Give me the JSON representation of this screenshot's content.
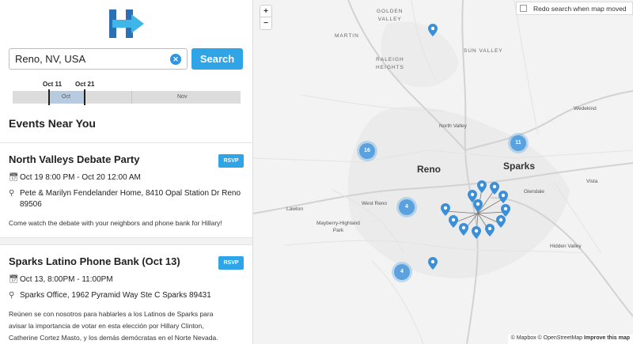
{
  "search": {
    "value": "Reno, NV, USA",
    "button_label": "Search"
  },
  "timeline": {
    "start_label": "Oct 11",
    "end_label": "Oct 21",
    "months": [
      "Oct",
      "Nov"
    ]
  },
  "events_heading": "Events Near You",
  "events": [
    {
      "title": "North Valleys Debate Party",
      "rsvp_label": "RSVP",
      "time": "Oct 19 8:00 PM - Oct 20 12:00 AM",
      "location": "Pete & Marilyn Fendelander Home, 8410 Opal Station Dr Reno 89506",
      "description": "Come watch the debate with your neighbors and phone bank for Hillary!"
    },
    {
      "title": "Sparks Latino Phone Bank (Oct 13)",
      "rsvp_label": "RSVP",
      "time": "Oct 13, 8:00PM - 11:00PM",
      "location": "Sparks Office, 1962 Pyramid Way Ste C Sparks 89431",
      "description": "Reúnen se con nosotros para hablarles a los Latinos de Sparks para avisar la importancia de votar en esta elección por Hillary Clinton, Catherine Cortez Masto, y los demás demócratas en el Norte Nevada."
    }
  ],
  "map": {
    "zoom_in": "+",
    "zoom_out": "−",
    "redo_label": "Redo search when map moved",
    "labels": {
      "golden_valley": "GOLDEN\nVALLEY",
      "martin": "MARTIN",
      "sun_valley": "SUN VALLEY",
      "raleigh_heights": "RALEIGH\nHEIGHTS",
      "wedekind": "Wedekind",
      "north_valley": "North Valley",
      "reno": "Reno",
      "sparks": "Sparks",
      "glendale": "Glendale",
      "vista": "Vista",
      "lawton": "Lawton",
      "west_reno": "West Reno",
      "mayberry": "Mayberry-Highland\nPark",
      "hidden_valley": "Hidden Valley"
    },
    "clusters": [
      "16",
      "11",
      "4",
      "4"
    ],
    "attribution": "© Mapbox © OpenStreetMap",
    "improve_link": "Improve this map"
  },
  "colors": {
    "accent": "#2fa4e7",
    "cluster": "#5aa2df",
    "logo_blue": "#2b6fb7",
    "logo_arrow": "#3fb6e8"
  },
  "icons": {
    "calendar": "calendar-icon",
    "location": "location-pin-icon",
    "clear": "clear-x-icon"
  }
}
